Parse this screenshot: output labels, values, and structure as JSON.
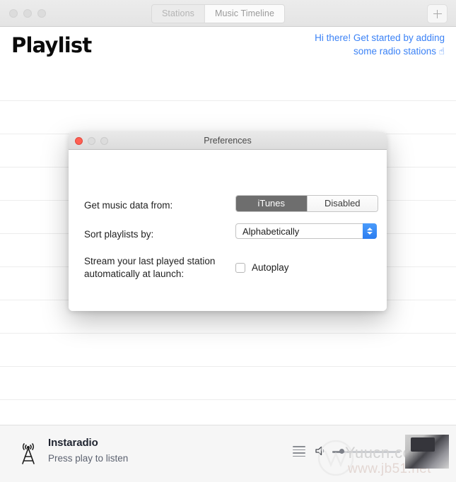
{
  "window": {
    "traffic_lights": [
      "close",
      "minimize",
      "zoom"
    ],
    "tabs": [
      {
        "label": "Stations",
        "active": false
      },
      {
        "label": "Music Timeline",
        "active": true
      }
    ],
    "add_button_icon": "plus-icon"
  },
  "header": {
    "title": "Playlist",
    "hint_line1": "Hi there! Get started by adding",
    "hint_line2": "some radio stations",
    "hint_emoji": "☝",
    "hint_color": "#3b82f6"
  },
  "list": {
    "row_count": 10,
    "rows": []
  },
  "player": {
    "station_icon": "radio-tower-icon",
    "title": "Instaradio",
    "subtitle": "Press play to listen",
    "queue_icon": "list-lines-icon",
    "volume_icon": "speaker-icon",
    "volume_percent": 12
  },
  "watermark": {
    "primary": "Yuucn.com",
    "secondary": "www.jb51.net"
  },
  "preferences": {
    "title": "Preferences",
    "traffic_lights": [
      "close",
      "minimize",
      "zoom"
    ],
    "source": {
      "label": "Get music data from:",
      "options": [
        "iTunes",
        "Disabled"
      ],
      "selected": "iTunes"
    },
    "sort": {
      "label": "Sort playlists by:",
      "selected": "Alphabetically",
      "stepper_color": "#2b7df0"
    },
    "stream": {
      "label": "Stream your last played station automatically at launch:",
      "checkbox_label": "Autoplay",
      "checked": false
    }
  }
}
